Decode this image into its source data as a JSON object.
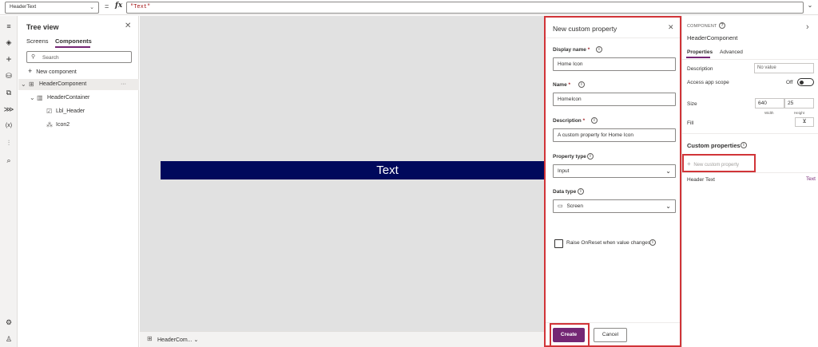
{
  "formula_bar": {
    "property": "HeaderText",
    "eq": "=",
    "fx": "fx",
    "formula": "\"Text\""
  },
  "left_rail": {
    "icons": [
      "menu-icon",
      "layers-icon",
      "insert-icon",
      "data-icon",
      "media-icon",
      "power-automate-icon",
      "variables-icon",
      "advanced-tools-icon",
      "search-icon",
      "settings-icon",
      "account-icon"
    ]
  },
  "tree_view": {
    "title": "Tree view",
    "tabs": [
      "Screens",
      "Components"
    ],
    "active_tab": "Components",
    "search_placeholder": "Search",
    "new_component": "New component",
    "items": [
      {
        "label": "HeaderComponent",
        "more": "···"
      },
      {
        "label": "HeaderContainer"
      },
      {
        "label": "Lbl_Header"
      },
      {
        "label": "Icon2"
      }
    ]
  },
  "canvas": {
    "header_text": "Text",
    "header_color": "#00095c",
    "bottom_label": "HeaderCom..."
  },
  "modal": {
    "title": "New custom property",
    "display_name_label": "Display name",
    "display_name_value": "Home Icon",
    "name_label": "Name",
    "name_value": "HomeIcon",
    "description_label": "Description",
    "description_value": "A custom property for Home Icon",
    "property_type_label": "Property type",
    "property_type_value": "Input",
    "data_type_label": "Data type",
    "data_type_value": "Screen",
    "raise_label": "Raise OnReset when value changes",
    "create_label": "Create",
    "cancel_label": "Cancel",
    "accent": "#742774",
    "highlight": "#d13438"
  },
  "properties": {
    "component_label": "COMPONENT",
    "name": "HeaderComponent",
    "tabs": [
      "Properties",
      "Advanced"
    ],
    "description_label": "Description",
    "description_placeholder": "No value",
    "access_scope_label": "Access app scope",
    "access_scope_value": "Off",
    "size_label": "Size",
    "width_value": "640",
    "height_value": "25",
    "width_caption": "Width",
    "height_caption": "Height",
    "fill_label": "Fill",
    "custom_properties_title": "Custom properties",
    "new_custom_property": "New custom property",
    "custom_props": [
      {
        "name": "Header Text",
        "type": "Text"
      }
    ]
  }
}
